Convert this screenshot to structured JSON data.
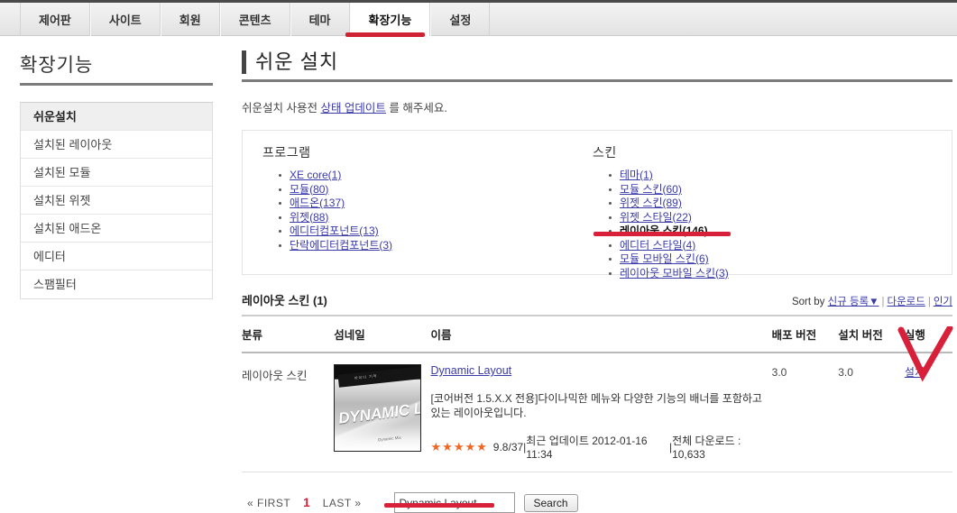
{
  "topnav": {
    "tabs": [
      {
        "label": "제어판",
        "active": false
      },
      {
        "label": "사이트",
        "active": false
      },
      {
        "label": "회원",
        "active": false
      },
      {
        "label": "콘텐츠",
        "active": false
      },
      {
        "label": "테마",
        "active": false
      },
      {
        "label": "확장기능",
        "active": true
      },
      {
        "label": "설정",
        "active": false
      }
    ]
  },
  "sidebar": {
    "title": "확장기능",
    "items": [
      {
        "label": "쉬운설치",
        "active": true
      },
      {
        "label": "설치된 레이아웃",
        "active": false
      },
      {
        "label": "설치된 모듈",
        "active": false
      },
      {
        "label": "설치된 위젯",
        "active": false
      },
      {
        "label": "설치된 애드온",
        "active": false
      },
      {
        "label": "에디터",
        "active": false
      },
      {
        "label": "스팸필터",
        "active": false
      }
    ]
  },
  "main": {
    "page_title": "쉬운 설치",
    "notice": {
      "before": "쉬운설치 사용전 ",
      "link": "상태 업데이트",
      "after": " 를 해주세요."
    },
    "package_box": {
      "program": {
        "heading": "프로그램",
        "items": [
          {
            "label": "XE core(1)",
            "highlight": false
          },
          {
            "label": "모듈(80)",
            "highlight": false
          },
          {
            "label": "애드온(137)",
            "highlight": false
          },
          {
            "label": "위젯(88)",
            "highlight": false
          },
          {
            "label": "에디터컴포넌트(13)",
            "highlight": false
          },
          {
            "label": "단락에디터컴포넌트(3)",
            "highlight": false
          }
        ]
      },
      "skin": {
        "heading": "스킨",
        "items": [
          {
            "label": "테마(1)",
            "highlight": false
          },
          {
            "label": "모듈 스킨(60)",
            "highlight": false
          },
          {
            "label": "위젯 스킨(89)",
            "highlight": false
          },
          {
            "label": "위젯 스타일(22)",
            "highlight": false
          },
          {
            "label": "레이아웃 스킨(146)",
            "highlight": true
          },
          {
            "label": "에디터 스타일(4)",
            "highlight": false
          },
          {
            "label": "모듈 모바일 스킨(6)",
            "highlight": false
          },
          {
            "label": "레이아웃 모바일 스킨(3)",
            "highlight": false
          }
        ]
      }
    },
    "list_header": {
      "count_label": "레이아웃 스킨 (1)",
      "sort_prefix": "Sort by ",
      "sort_options": [
        "신규 등록▼",
        "다운로드",
        "인기"
      ]
    },
    "table": {
      "columns": [
        "분류",
        "섬네일",
        "이름",
        "배포 버전",
        "설치 버전",
        "실행"
      ],
      "rows": [
        {
          "category": "레이아웃 스킨",
          "thumbnail": {
            "top_label": "아이디 기억",
            "word": "DYNAMIC L",
            "footer": "Dynamic Mix"
          },
          "name": "Dynamic Layout",
          "description": "[코어버전 1.5.X.X 전용]다이나믹한 메뉴와 다양한 기능의 배너를 포함하고 있는 레이아웃입니다.",
          "stars": "★★★★★",
          "rating": "9.8/37",
          "updated_label": "최근 업데이트 2012-01-16 11:34",
          "downloads_label": "전체 다운로드 : 10,633",
          "meta_sep": " | ",
          "dist_version": "3.0",
          "installed_version": "3.0",
          "run_label": "설치"
        }
      ]
    },
    "footer": {
      "first": "« FIRST",
      "current_page": "1",
      "last": "LAST »",
      "search_value": "Dynamic Layout",
      "search_placeholder": "",
      "search_button": "Search"
    }
  },
  "annotations": {
    "accent_red": "#d8203a",
    "tab_underline": "red-underline-active-tab",
    "skin_underline": "red-underline-layout-skin",
    "run_check": "red-check-mark",
    "search_underline": "red-underline-search-input"
  }
}
